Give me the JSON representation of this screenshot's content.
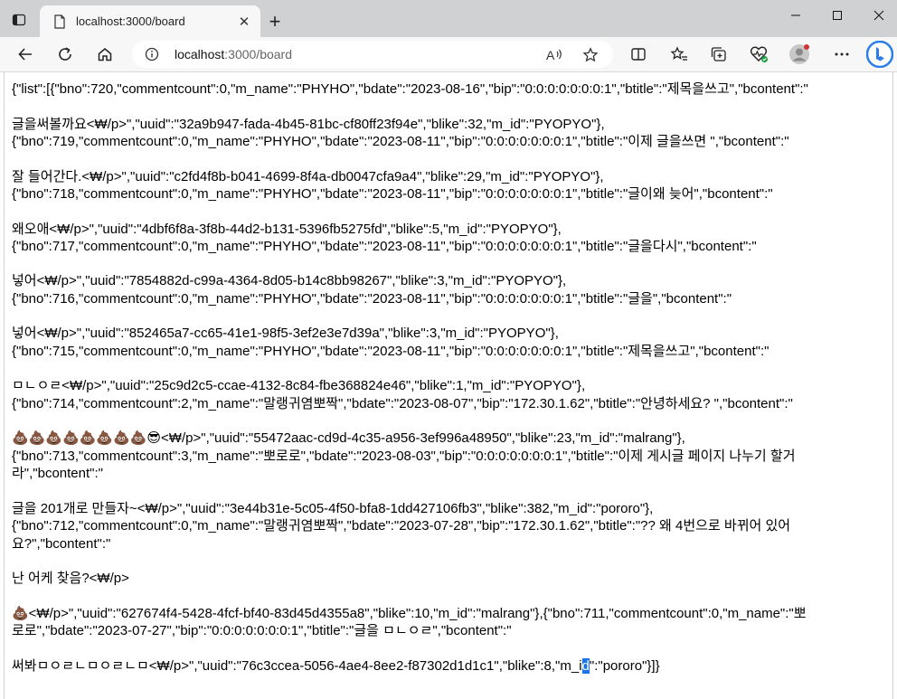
{
  "browser": {
    "tab_title": "localhost:3000/board",
    "url_host": "localhost",
    "url_rest": ":3000/board"
  },
  "icons": {
    "back": "arrow-left-icon",
    "refresh": "refresh-icon",
    "home": "home-icon",
    "info": "info-icon",
    "read_aloud": "read-aloud-icon",
    "favorite": "star-icon",
    "split": "split-screen-icon",
    "favorites": "favorites-icon",
    "collections": "collections-icon",
    "health": "browser-essentials-icon",
    "profile": "profile-avatar-icon",
    "more": "more-icon",
    "copilot": "bing-icon"
  },
  "page": {
    "paragraphs": [
      [
        "{\"list\":[{\"bno\":720,\"commentcount\":0,\"m_name\":\"PHYHO\",\"bdate\":\"2023-08-16\",\"bip\":\"0:0:0:0:0:0:0:1\",\"btitle\":\"제목을쓰고\",\"bcontent\":\""
      ],
      [
        "글을써볼까요<₩/p>\",\"uuid\":\"32a9b947-fada-4b45-81bc-cf80ff23f94e\",\"blike\":32,\"m_id\":\"PYOPYO\"},",
        "{\"bno\":719,\"commentcount\":0,\"m_name\":\"PHYHO\",\"bdate\":\"2023-08-11\",\"bip\":\"0:0:0:0:0:0:0:1\",\"btitle\":\"이제 글을쓰면 \",\"bcontent\":\""
      ],
      [
        "잘 들어간다.<₩/p>\",\"uuid\":\"c2fd4f8b-b041-4699-8f4a-db0047cfa9a4\",\"blike\":29,\"m_id\":\"PYOPYO\"},",
        "{\"bno\":718,\"commentcount\":0,\"m_name\":\"PHYHO\",\"bdate\":\"2023-08-11\",\"bip\":\"0:0:0:0:0:0:0:1\",\"btitle\":\"글이왜 늦어\",\"bcontent\":\""
      ],
      [
        "왜오애<₩/p>\",\"uuid\":\"4dbf6f8a-3f8b-44d2-b131-5396fb5275fd\",\"blike\":5,\"m_id\":\"PYOPYO\"},",
        "{\"bno\":717,\"commentcount\":0,\"m_name\":\"PHYHO\",\"bdate\":\"2023-08-11\",\"bip\":\"0:0:0:0:0:0:0:1\",\"btitle\":\"글을다시\",\"bcontent\":\""
      ],
      [
        "넣어<₩/p>\",\"uuid\":\"7854882d-c99a-4364-8d05-b14c8bb98267\",\"blike\":3,\"m_id\":\"PYOPYO\"},",
        "{\"bno\":716,\"commentcount\":0,\"m_name\":\"PHYHO\",\"bdate\":\"2023-08-11\",\"bip\":\"0:0:0:0:0:0:0:1\",\"btitle\":\"글을\",\"bcontent\":\""
      ],
      [
        "넣어<₩/p>\",\"uuid\":\"852465a7-cc65-41e1-98f5-3ef2e3e7d39a\",\"blike\":3,\"m_id\":\"PYOPYO\"},",
        "{\"bno\":715,\"commentcount\":0,\"m_name\":\"PHYHO\",\"bdate\":\"2023-08-11\",\"bip\":\"0:0:0:0:0:0:0:1\",\"btitle\":\"제목을쓰고\",\"bcontent\":\""
      ],
      [
        "ㅁㄴㅇㄹ<₩/p>\",\"uuid\":\"25c9d2c5-ccae-4132-8c84-fbe368824e46\",\"blike\":1,\"m_id\":\"PYOPYO\"},",
        "{\"bno\":714,\"commentcount\":2,\"m_name\":\"말랭귀염뽀짝\",\"bdate\":\"2023-08-07\",\"bip\":\"172.30.1.62\",\"btitle\":\"안녕하세요? \",\"bcontent\":\""
      ],
      [
        "💩💩💩💩💩💩💩💩😎<₩/p>\",\"uuid\":\"55472aac-cd9d-4c35-a956-3ef996a48950\",\"blike\":23,\"m_id\":\"malrang\"},",
        "{\"bno\":713,\"commentcount\":3,\"m_name\":\"뽀로로\",\"bdate\":\"2023-08-03\",\"bip\":\"0:0:0:0:0:0:0:1\",\"btitle\":\"이제 게시글 페이지 나누기 할거",
        "라\",\"bcontent\":\""
      ],
      [
        "글을 201개로 만들자~<₩/p>\",\"uuid\":\"3e44b31e-5c05-4f50-bfa8-1dd427106fb3\",\"blike\":382,\"m_id\":\"pororo\"},",
        "{\"bno\":712,\"commentcount\":0,\"m_name\":\"말랭귀염뽀짝\",\"bdate\":\"2023-07-28\",\"bip\":\"172.30.1.62\",\"btitle\":\"?? 왜 4번으로 바뀌어 있어",
        "요?\",\"bcontent\":\""
      ],
      [
        "난 어케 찾음?<₩/p>"
      ],
      [
        "💩<₩/p>\",\"uuid\":\"627674f4-5428-4fcf-bf40-83d45d4355a8\",\"blike\":10,\"m_id\":\"malrang\"},{\"bno\":711,\"commentcount\":0,\"m_name\":\"뽀",
        "로로\",\"bdate\":\"2023-07-27\",\"bip\":\"0:0:0:0:0:0:0:1\",\"btitle\":\"글을 ㅁㄴㅇㄹ\",\"bcontent\":\""
      ]
    ],
    "last_line_before": "써봐ㅁㅇㄹㄴㅁㅇㄹㄴㅁ<₩/p>\",\"uuid\":\"76c3ccea-5056-4ae4-8ee2-f87302d1d1c1\",\"blike\":8,\"m_i",
    "last_line_selected": "d",
    "last_line_after": "\":\"pororo\"}]}"
  }
}
